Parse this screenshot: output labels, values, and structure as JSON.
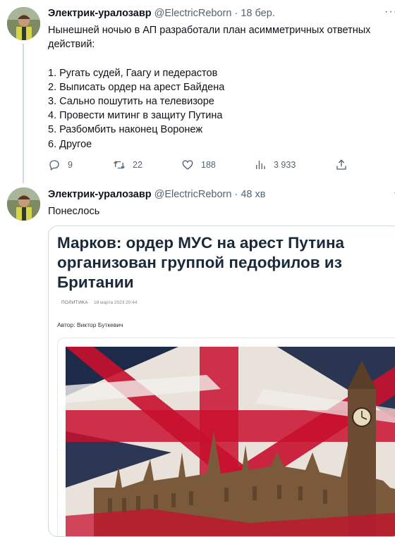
{
  "tweets": [
    {
      "author_name": "Электрик-уралозавр",
      "handle": "@ElectricReborn",
      "separator": "·",
      "time": "18 бер.",
      "text_lines": [
        "Нынешней ночью в АП разработали план асимметричных ответных",
        "действий:",
        "",
        "1. Ругать судей, Гаагу и педерастов",
        "2. Выписать ордер на арест Байдена",
        "3. Сально пошутить на телевизоре",
        "4. Провести митинг в защиту Путина",
        "5. Разбомбить наконец Воронеж",
        "6. Другое"
      ],
      "actions": {
        "reply_count": "9",
        "retweet_count": "22",
        "like_count": "188",
        "views_count": "3 933"
      }
    },
    {
      "author_name": "Электрик-уралозавр",
      "handle": "@ElectricReborn",
      "separator": "·",
      "time": "48 хв",
      "text": "Понеслось",
      "card": {
        "headline_lines": [
          "Марков: ордер МУС на арест Путина",
          "организован группой педофилов из",
          "Британии"
        ],
        "category": "ПОЛИТИКА",
        "date": "18 марта 2023 20:44",
        "author": "Автор: Виктор Буткевич"
      }
    }
  ],
  "icons": {
    "reply": "reply-icon",
    "retweet": "retweet-icon",
    "like": "like-icon",
    "views": "views-icon",
    "share": "share-icon",
    "more": "more-icon"
  },
  "colors": {
    "text": "#0f1419",
    "muted": "#536471",
    "border": "#cfd9de",
    "flag_red": "#c8102e",
    "flag_blue": "#1e2a4a",
    "building": "#7a5a3a"
  }
}
